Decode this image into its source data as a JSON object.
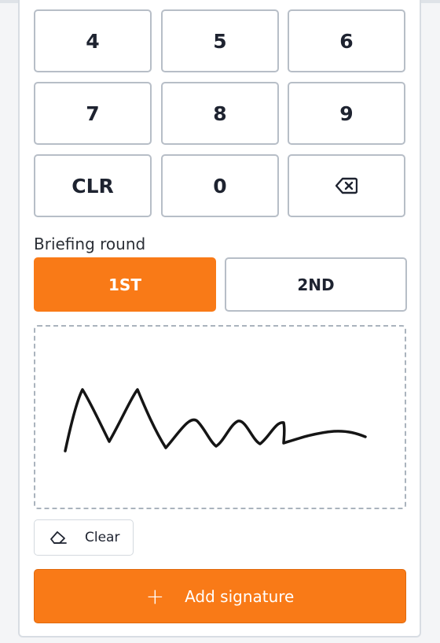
{
  "keypad": {
    "keys": [
      "4",
      "5",
      "6",
      "7",
      "8",
      "9",
      "CLR",
      "0"
    ],
    "backspace_icon": "backspace-icon"
  },
  "briefing": {
    "label": "Briefing round",
    "options": [
      "1ST",
      "2ND"
    ],
    "selected": "1ST"
  },
  "signature": {
    "clear_label": "Clear",
    "clear_icon": "eraser-icon",
    "add_label": "Add signature",
    "add_icon": "plus-icon"
  },
  "colors": {
    "accent": "#f97a17",
    "border": "#b7bec7"
  }
}
